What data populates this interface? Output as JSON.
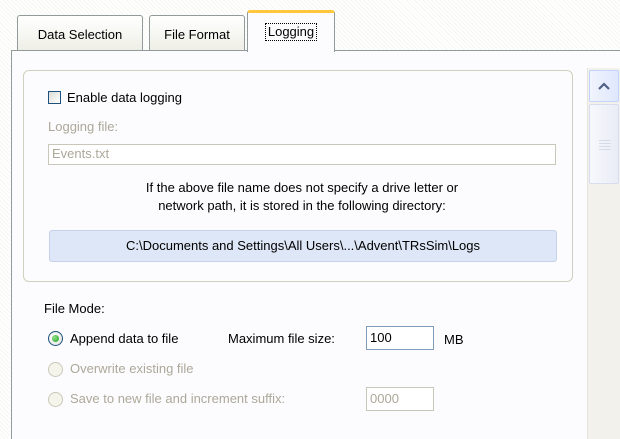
{
  "tabs": [
    {
      "label": "Data Selection",
      "active": false
    },
    {
      "label": "File Format",
      "active": false
    },
    {
      "label": "Logging",
      "active": true
    }
  ],
  "logging": {
    "enable_label": "Enable data logging",
    "enable_checked": false,
    "file_label": "Logging file:",
    "file_value": "Events.txt",
    "info_line1": "If the above file name does not specify a drive letter or",
    "info_line2": "network path, it is stored in the following directory:",
    "directory": "C:\\Documents and Settings\\All Users\\...\\Advent\\TRsSim\\Logs"
  },
  "file_mode": {
    "label": "File Mode:",
    "options": [
      {
        "label": "Append data to file",
        "selected": true,
        "enabled": true
      },
      {
        "label": "Overwrite existing file",
        "selected": false,
        "enabled": false
      },
      {
        "label": "Save to new file and increment suffix:",
        "selected": false,
        "enabled": false
      }
    ],
    "max_size_label": "Maximum file size:",
    "max_size_value": "100",
    "max_size_unit": "MB",
    "suffix_value": "0000"
  },
  "icons": {
    "scroll_up": "chevron-up-icon"
  },
  "colors": {
    "active_tab_highlight": "#ffc83c",
    "path_box_bg": "#dee7f7",
    "radio_selected": "#21a121"
  }
}
